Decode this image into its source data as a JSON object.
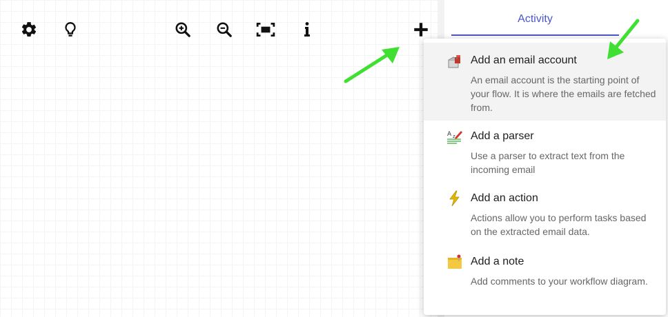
{
  "right_panel": {
    "tab_label": "Activity",
    "accent_color": "#4a56c5"
  },
  "toolbar": {
    "icons": [
      "gear-icon",
      "lightbulb-icon",
      "zoom-in-icon",
      "zoom-out-icon",
      "fit-screen-icon",
      "info-icon",
      "plus-icon"
    ]
  },
  "add_menu": {
    "items": [
      {
        "title": "Add an email account",
        "description": "An email account is the starting point of your flow. It is where the emails are fetched from.",
        "icon": "mailbox-icon"
      },
      {
        "title": "Add a parser",
        "description": "Use a parser to extract text from the incoming email",
        "icon": "parser-icon"
      },
      {
        "title": "Add an action",
        "description": "Actions allow you to perform tasks based on the extracted email data.",
        "icon": "lightning-icon"
      },
      {
        "title": "Add a note",
        "description": "Add comments to your workflow diagram.",
        "icon": "sticky-note-icon"
      }
    ]
  },
  "annotation_color": "#3fe032"
}
